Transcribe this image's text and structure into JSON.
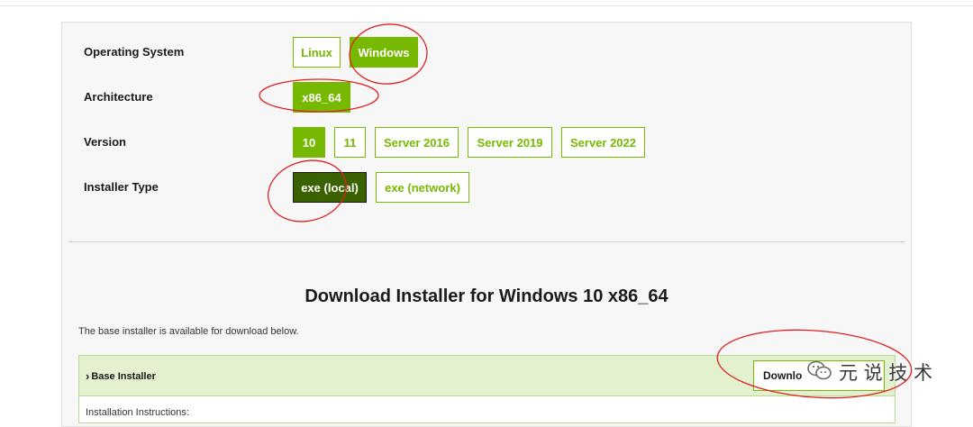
{
  "selector": {
    "os": {
      "label": "Operating System",
      "options": [
        "Linux",
        "Windows"
      ],
      "selected": "Windows"
    },
    "arch": {
      "label": "Architecture",
      "options": [
        "x86_64"
      ],
      "selected": "x86_64"
    },
    "version": {
      "label": "Version",
      "options": [
        "10",
        "11",
        "Server 2016",
        "Server 2019",
        "Server 2022"
      ],
      "selected": "10"
    },
    "installer_type": {
      "label": "Installer Type",
      "options": [
        "exe (local)",
        "exe (network)"
      ],
      "selected": "exe (local)"
    }
  },
  "download": {
    "title": "Download Installer for Windows 10 x86_64",
    "description": "The base installer is available for download below.",
    "base_installer_label": "Base Installer",
    "download_button_label": "Downlo",
    "instructions_label": "Installation Instructions:"
  },
  "watermark": {
    "text": "元 说 技 术",
    "icon": "wechat-icon"
  },
  "colors": {
    "accent": "#76b900",
    "accent_dark": "#3a6200",
    "annotation": "#e02020"
  }
}
